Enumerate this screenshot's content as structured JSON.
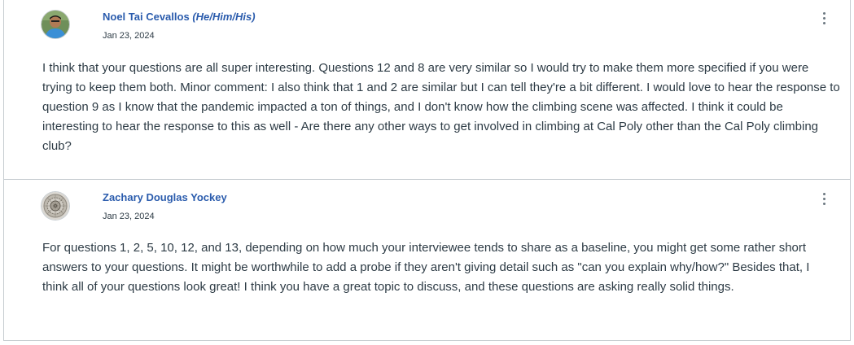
{
  "replies": [
    {
      "author": "Noel Tai Cevallos",
      "pronouns": "(He/Him/His)",
      "date": "Jan 23, 2024",
      "body": "I think that your questions are all super interesting. Questions 12 and 8 are very similar so I would try to make them more specified if you were trying to keep them both. Minor comment: I also think that 1 and 2 are similar but I can tell they're a bit different. I would love to hear the response to question 9 as I know that the pandemic impacted a ton of things, and I don't know how the climbing scene was affected. I think it could be interesting to hear the response to this as well - Are there any other ways to get involved in climbing at Cal Poly other than the Cal Poly climbing club?",
      "avatar_icon": "user-photo-icon",
      "menu_icon": "kebab-menu-icon"
    },
    {
      "author": "Zachary Douglas Yockey",
      "date": "Jan 23, 2024",
      "body": "For questions 1, 2, 5, 10, 12, and 13, depending on how much your interviewee tends to share as a baseline, you might get some rather short answers to your questions. It might be worthwhile to add a probe if they aren't giving detail such as \"can you explain why/how?\" Besides that, I think all of your questions look great! I think you have a great topic to discuss, and these questions are asking really solid things.",
      "avatar_icon": "clock-mechanism-icon",
      "menu_icon": "kebab-menu-icon"
    }
  ],
  "colors": {
    "author_link": "#2b5cad",
    "body_text": "#2d3b45",
    "border": "#c7cdd1"
  }
}
